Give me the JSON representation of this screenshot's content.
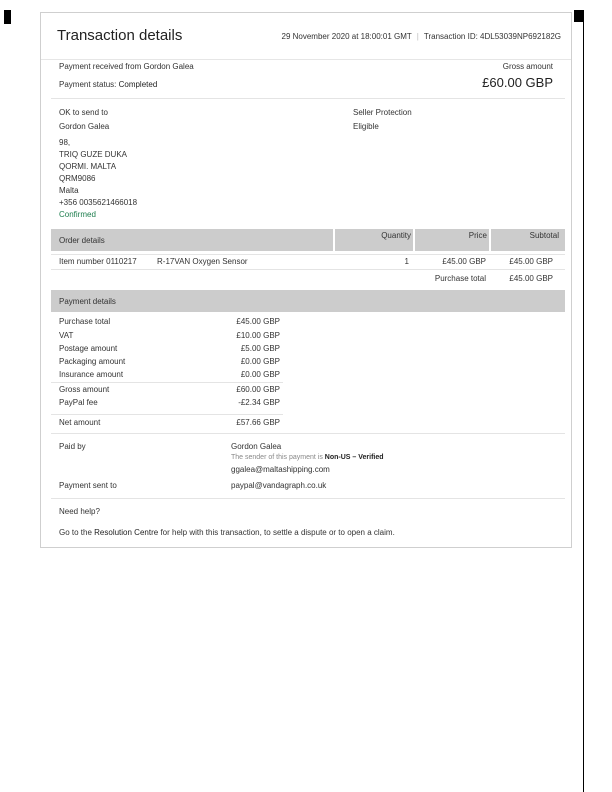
{
  "header": {
    "title": "Transaction details",
    "date": "29 November 2020 at 18:00:01 GMT",
    "transaction_label": "Transaction ID: 4DL53039NP692182G"
  },
  "summary": {
    "payment_received": "Payment received from Gordon Galea",
    "status_label": "Payment status:",
    "status_value": "Completed",
    "gross_label": "Gross amount",
    "gross_value": "£60.00 GBP"
  },
  "shipping": {
    "ok_label": "OK to send to",
    "name": "Gordon Galea",
    "address": [
      "98,",
      "TRIQ GUZE DUKA",
      "QORMI. MALTA",
      "QRM9086",
      "Malta",
      "+356 0035621466018"
    ],
    "confirmed": "Confirmed",
    "seller_protection_label": "Seller Protection",
    "seller_protection_value": "Eligible"
  },
  "order": {
    "header_label": "Order details",
    "col_quantity": "Quantity",
    "col_price": "Price",
    "col_subtotal": "Subtotal",
    "item_number": "Item number 0110217",
    "item_name": "R-17VAN Oxygen Sensor",
    "quantity": "1",
    "price": "£45.00 GBP",
    "subtotal": "£45.00 GBP",
    "purchase_total_label": "Purchase total",
    "purchase_total_value": "£45.00 GBP"
  },
  "payment": {
    "header_label": "Payment details",
    "rows": [
      {
        "label": "Purchase total",
        "value": "£45.00 GBP"
      },
      {
        "label": "VAT",
        "value": "£10.00 GBP"
      },
      {
        "label": "Postage amount",
        "value": "£5.00 GBP"
      },
      {
        "label": "Packaging amount",
        "value": "£0.00 GBP"
      },
      {
        "label": "Insurance amount",
        "value": "£0.00 GBP"
      },
      {
        "label": "Gross amount",
        "value": "£60.00 GBP"
      },
      {
        "label": "PayPal fee",
        "value": "-£2.34 GBP"
      },
      {
        "label": "Net amount",
        "value": "£57.66 GBP"
      }
    ],
    "paid_by_label": "Paid by",
    "paid_by_name": "Gordon Galea",
    "sender_note": "The sender of this payment is",
    "sender_status": "Non-US – Verified",
    "paid_by_email": "ggalea@maltashipping.com",
    "sent_to_label": "Payment sent to",
    "sent_to_value": "paypal@vandagraph.co.uk"
  },
  "help": {
    "title": "Need help?",
    "prefix": "Go to the",
    "link": "Resolution Centre",
    "suffix": "for help with this transaction, to settle a dispute or to open a claim."
  }
}
